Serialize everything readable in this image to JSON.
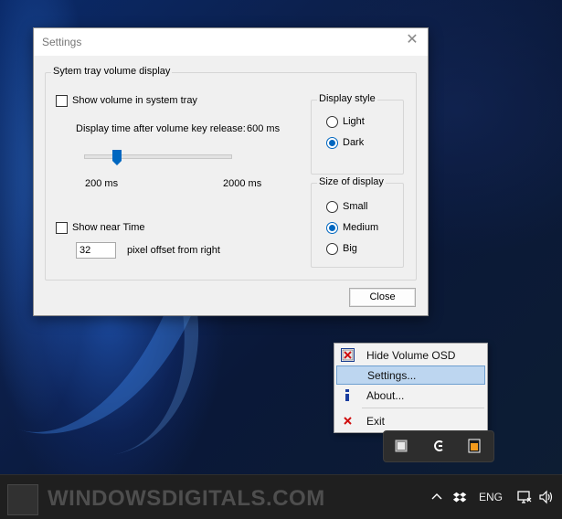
{
  "dialog": {
    "title": "Settings",
    "group_label": "Sytem tray volume display",
    "show_volume_label": "Show volume in system tray",
    "display_time_label": "Display time after volume key release:",
    "display_time_value": "600 ms",
    "slider_min_label": "200 ms",
    "slider_max_label": "2000 ms",
    "slider_value": 600,
    "slider_min": 200,
    "slider_max": 2000,
    "show_near_time_label": "Show near Time",
    "offset_value": "32",
    "offset_label": "pixel offset from right",
    "display_style": {
      "label": "Display style",
      "options": [
        "Light",
        "Dark"
      ],
      "selected": "Dark"
    },
    "size_of_display": {
      "label": "Size of display",
      "options": [
        "Small",
        "Medium",
        "Big"
      ],
      "selected": "Medium"
    },
    "close_label": "Close"
  },
  "context_menu": {
    "items": [
      {
        "label": "Hide Volume OSD",
        "icon": "red-x-box-icon"
      },
      {
        "label": "Settings...",
        "icon": "",
        "highlighted": true
      },
      {
        "label": "About...",
        "icon": "info-icon"
      },
      {
        "label": "Exit",
        "icon": "red-x-icon"
      }
    ]
  },
  "tray_overflow": {
    "icons": [
      "volume-osd-tray-icon",
      "app-g-tray-icon",
      "orange-app-tray-icon"
    ]
  },
  "taskbar": {
    "watermark": "WINDOWSDIGITALS.COM",
    "language": "ENG",
    "icons": [
      "chevron-up-icon",
      "dropbox-icon",
      "network-icon",
      "speaker-icon"
    ]
  },
  "colors": {
    "accent": "#0067c0",
    "menu_highlight": "#bdd6f0",
    "taskbar": "#1f1f1f"
  }
}
